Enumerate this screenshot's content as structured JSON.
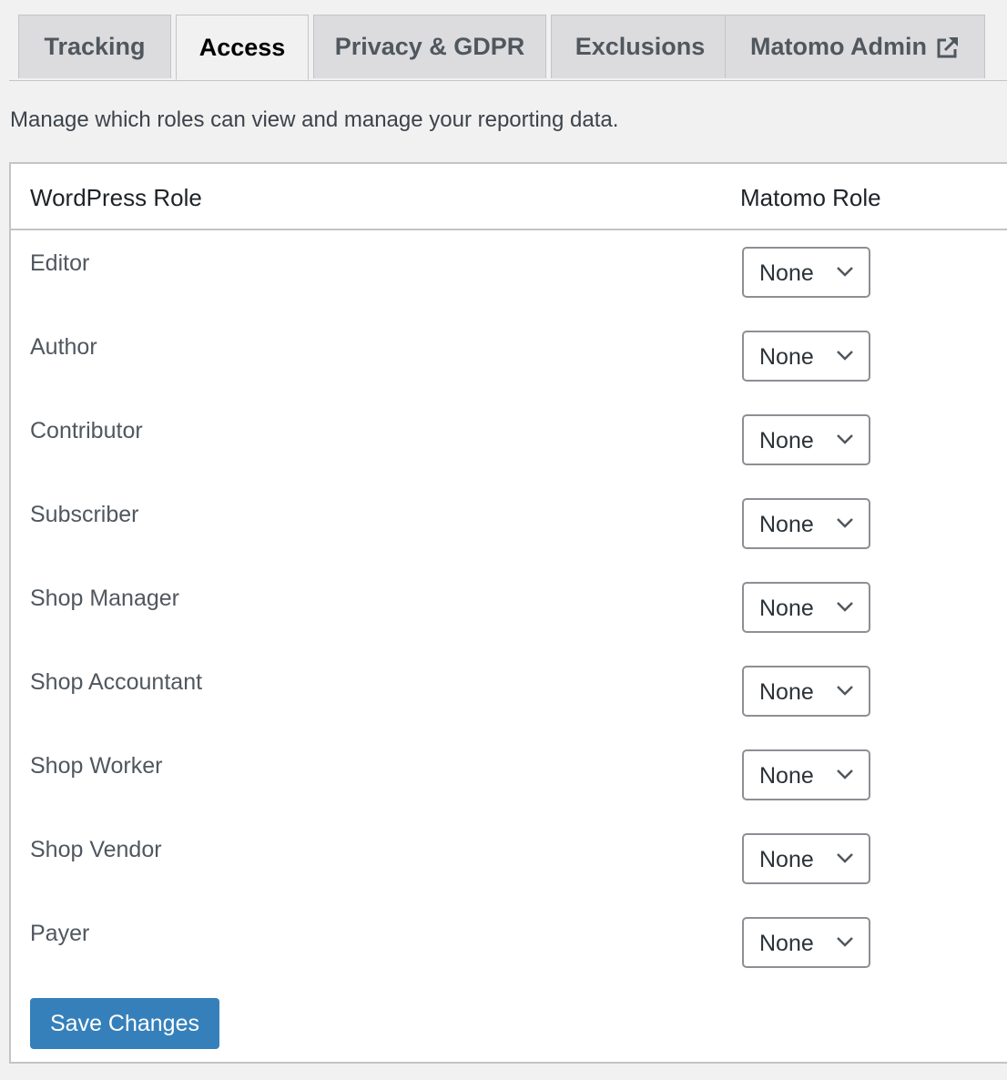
{
  "tabs": [
    {
      "label": "Tracking",
      "active": false
    },
    {
      "label": "Access",
      "active": true
    },
    {
      "label": "Privacy & GDPR",
      "active": false
    },
    {
      "label": "Exclusions",
      "active": false
    },
    {
      "label": "Matomo Admin",
      "active": false,
      "icon": "external-link-icon"
    }
  ],
  "description": "Manage which roles can view and manage your reporting data.",
  "table": {
    "headers": [
      "WordPress Role",
      "Matomo Role"
    ],
    "rows": [
      {
        "role": "Editor",
        "matomo_role": "None"
      },
      {
        "role": "Author",
        "matomo_role": "None"
      },
      {
        "role": "Contributor",
        "matomo_role": "None"
      },
      {
        "role": "Subscriber",
        "matomo_role": "None"
      },
      {
        "role": "Shop Manager",
        "matomo_role": "None"
      },
      {
        "role": "Shop Accountant",
        "matomo_role": "None"
      },
      {
        "role": "Shop Worker",
        "matomo_role": "None"
      },
      {
        "role": "Shop Vendor",
        "matomo_role": "None"
      },
      {
        "role": "Payer",
        "matomo_role": "None"
      }
    ]
  },
  "save_button": "Save Changes",
  "colors": {
    "primary": "#3580bb",
    "background": "#f1f1f1"
  }
}
